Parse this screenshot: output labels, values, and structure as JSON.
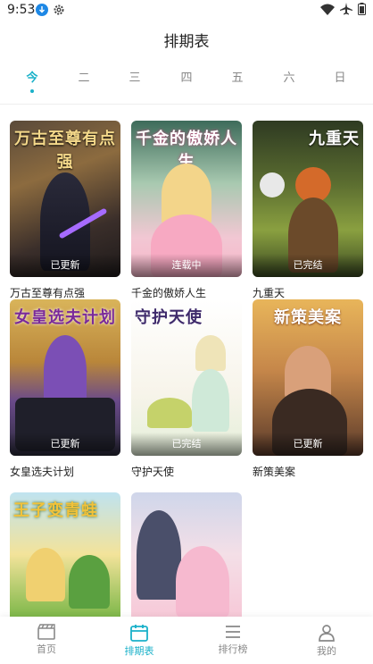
{
  "status_bar": {
    "time": "9:53"
  },
  "page": {
    "title": "排期表"
  },
  "tabs": [
    {
      "label": "今",
      "active": true
    },
    {
      "label": "二",
      "active": false
    },
    {
      "label": "三",
      "active": false
    },
    {
      "label": "四",
      "active": false
    },
    {
      "label": "五",
      "active": false
    },
    {
      "label": "六",
      "active": false
    },
    {
      "label": "日",
      "active": false
    }
  ],
  "comics": [
    {
      "name": "万古至尊有点强",
      "cover_title": "万古至尊有点强",
      "status": "已更新"
    },
    {
      "name": "千金的傲娇人生",
      "cover_title": "千金的傲娇人生",
      "status": "连载中"
    },
    {
      "name": "九重天",
      "cover_title": "九重天",
      "status": "已完结"
    },
    {
      "name": "女皇选夫计划",
      "cover_title": "女皇选夫计划",
      "status": "已更新"
    },
    {
      "name": "守护天使",
      "cover_title": "守护天使",
      "status": "已完结"
    },
    {
      "name": "新策美案",
      "cover_title": "新策美案",
      "status": "已更新"
    },
    {
      "name": "",
      "cover_title": "王子变青蛙",
      "status": ""
    },
    {
      "name": "",
      "cover_title": "",
      "status": ""
    }
  ],
  "bottom_nav": [
    {
      "label": "首页",
      "icon": "clapperboard-icon",
      "active": false
    },
    {
      "label": "排期表",
      "icon": "calendar-icon",
      "active": true
    },
    {
      "label": "排行榜",
      "icon": "list-icon",
      "active": false
    },
    {
      "label": "我的",
      "icon": "person-icon",
      "active": false
    }
  ],
  "colors": {
    "accent": "#1ab1c9"
  }
}
